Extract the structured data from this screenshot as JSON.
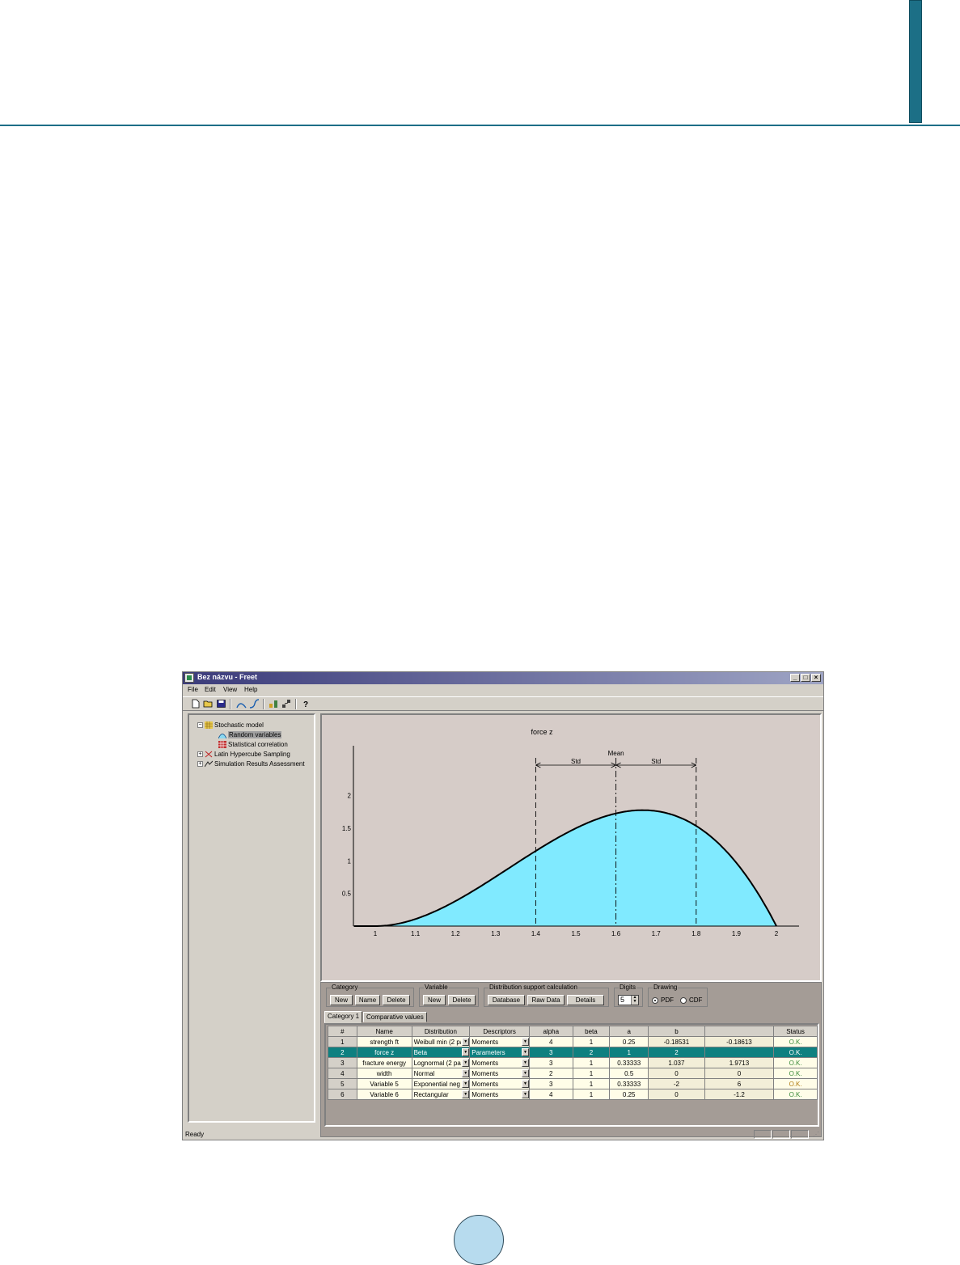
{
  "window": {
    "title": "Bez názvu - Freet"
  },
  "menu": [
    "File",
    "Edit",
    "View",
    "Help"
  ],
  "toolbar": {
    "icons": [
      "new-icon",
      "open-icon",
      "save-icon",
      "pdf-icon",
      "cdf-icon",
      "generate-icon",
      "export-icon",
      "help-icon"
    ]
  },
  "tree": {
    "root": "Stochastic model",
    "children": [
      "Random variables",
      "Statistical correlation"
    ],
    "siblings": [
      "Latin Hypercube Sampling",
      "Simulation Results Assessment"
    ]
  },
  "chart": {
    "title": "force z",
    "mean_label": "Mean",
    "std_label": "Std",
    "fill_color": "#80eaff",
    "x_ticks": [
      "1",
      "1.1",
      "1.2",
      "1.3",
      "1.4",
      "1.5",
      "1.6",
      "1.7",
      "1.8",
      "1.9",
      "2"
    ],
    "y_ticks": [
      "0.5",
      "1",
      "1.5",
      "2"
    ]
  },
  "chart_data": {
    "type": "area",
    "title": "force z",
    "xlim": [
      1,
      2
    ],
    "ylim": [
      0,
      2
    ],
    "distribution": "Beta",
    "alpha": 3,
    "beta": 2,
    "a": 1,
    "b": 2,
    "mean": 1.6,
    "std_bounds": [
      1.4,
      1.8
    ],
    "x": [
      1.0,
      1.1,
      1.2,
      1.3,
      1.4,
      1.5,
      1.6,
      1.7,
      1.8,
      1.9,
      2.0
    ],
    "y": [
      0.0,
      0.108,
      0.384,
      0.756,
      1.152,
      1.5,
      1.728,
      1.764,
      1.536,
      0.972,
      0.0
    ]
  },
  "controls": {
    "category": {
      "legend": "Category",
      "buttons": [
        "New",
        "Name",
        "Delete"
      ]
    },
    "variable": {
      "legend": "Variable",
      "buttons": [
        "New",
        "Delete"
      ]
    },
    "distribution": {
      "legend": "Distribution support calculation",
      "buttons": [
        "Database",
        "Raw Data",
        "Details"
      ]
    },
    "digits": {
      "legend": "Digits",
      "value": "5"
    },
    "drawing": {
      "legend": "Drawing",
      "options": [
        "PDF",
        "CDF"
      ],
      "selected": "PDF"
    }
  },
  "tabs": [
    "Category 1",
    "Comparative values"
  ],
  "table": {
    "headers": [
      "#",
      "Name",
      "Distribution",
      "Descriptors",
      "alpha",
      "beta",
      "a",
      "b",
      "",
      "Status"
    ],
    "rows": [
      [
        "1",
        "strength ft",
        "Weibull min (2 pa",
        "Moments",
        "4",
        "1",
        "0.25",
        "-0.18531",
        "-0.18613",
        "O.K."
      ],
      [
        "2",
        "force z",
        "Beta",
        "Parameters",
        "3",
        "2",
        "1",
        "2",
        "",
        "O.K."
      ],
      [
        "3",
        "fracture energy",
        "Lognormal (2 pa",
        "Moments",
        "3",
        "1",
        "0.33333",
        "1.037",
        "1.9713",
        "O.K."
      ],
      [
        "4",
        "width",
        "Normal",
        "Moments",
        "2",
        "1",
        "0.5",
        "0",
        "0",
        "O.K."
      ],
      [
        "5",
        "Variable 5",
        "Exponential neg",
        "Moments",
        "3",
        "1",
        "0.33333",
        "-2",
        "6",
        "O.K."
      ],
      [
        "6",
        "Variable 6",
        "Rectangular",
        "Moments",
        "4",
        "1",
        "0.25",
        "0",
        "-1.2",
        "O.K."
      ]
    ],
    "selected_row": 1,
    "status_colors": [
      "#3a8a3a",
      "#ffffff",
      "#3a8a3a",
      "#3a8a3a",
      "#b07a10",
      "#3a8a3a"
    ]
  },
  "statusbar": {
    "text": "Ready"
  }
}
